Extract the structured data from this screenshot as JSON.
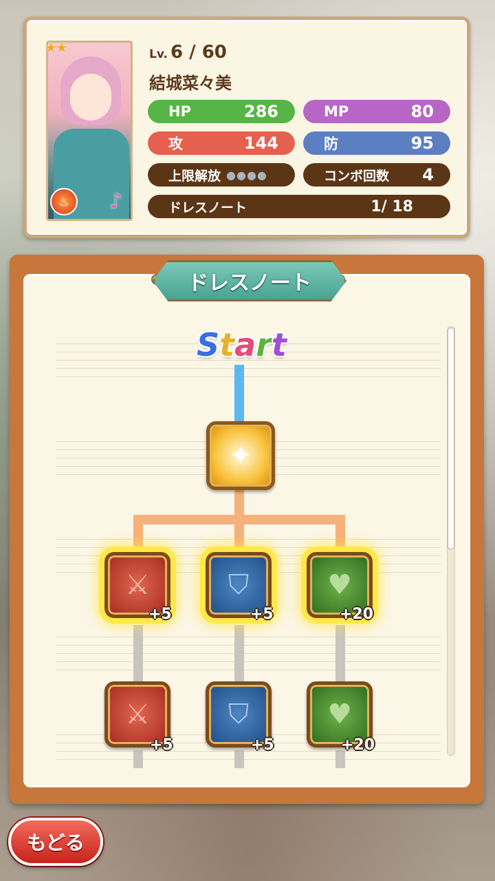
{
  "character": {
    "rarity_stars": "★★",
    "level_prefix": "Lv.",
    "level": "6 / 60",
    "name": "結城菜々美"
  },
  "stats": {
    "hp_label": "HP",
    "hp_value": "286",
    "mp_label": "MP",
    "mp_value": "80",
    "atk_label": "攻",
    "atk_value": "144",
    "def_label": "防",
    "def_value": "95",
    "limit_label": "上限解放",
    "limit_gems": "●●●●",
    "combo_label": "コンボ回数",
    "combo_value": "4",
    "dress_label": "ドレスノート",
    "dress_value": "1/ 18"
  },
  "panel": {
    "title": "ドレスノート",
    "start_letters": [
      "S",
      "t",
      "a",
      "r",
      "t"
    ]
  },
  "nodes": {
    "row1": [
      {
        "type": "attack",
        "bonus": "+5"
      },
      {
        "type": "defense",
        "bonus": "+5"
      },
      {
        "type": "hp",
        "bonus": "+20"
      }
    ],
    "row2": [
      {
        "type": "attack",
        "bonus": "+5"
      },
      {
        "type": "defense",
        "bonus": "+5"
      },
      {
        "type": "hp",
        "bonus": "+20"
      }
    ]
  },
  "icons": {
    "attack": "sword-icon",
    "defense": "shield-icon",
    "hp": "heart-icon",
    "start": "spotlight-icon",
    "element": "fire-icon",
    "music": "music-note-icon"
  },
  "colors": {
    "hp": "#56b545",
    "mp": "#b766c6",
    "atk": "#e5604f",
    "def": "#5c7fc2",
    "panel": "#c7773b",
    "title_plate": "#4ba391",
    "back_button": "#d8342a"
  },
  "footer": {
    "back_label": "もどる"
  }
}
